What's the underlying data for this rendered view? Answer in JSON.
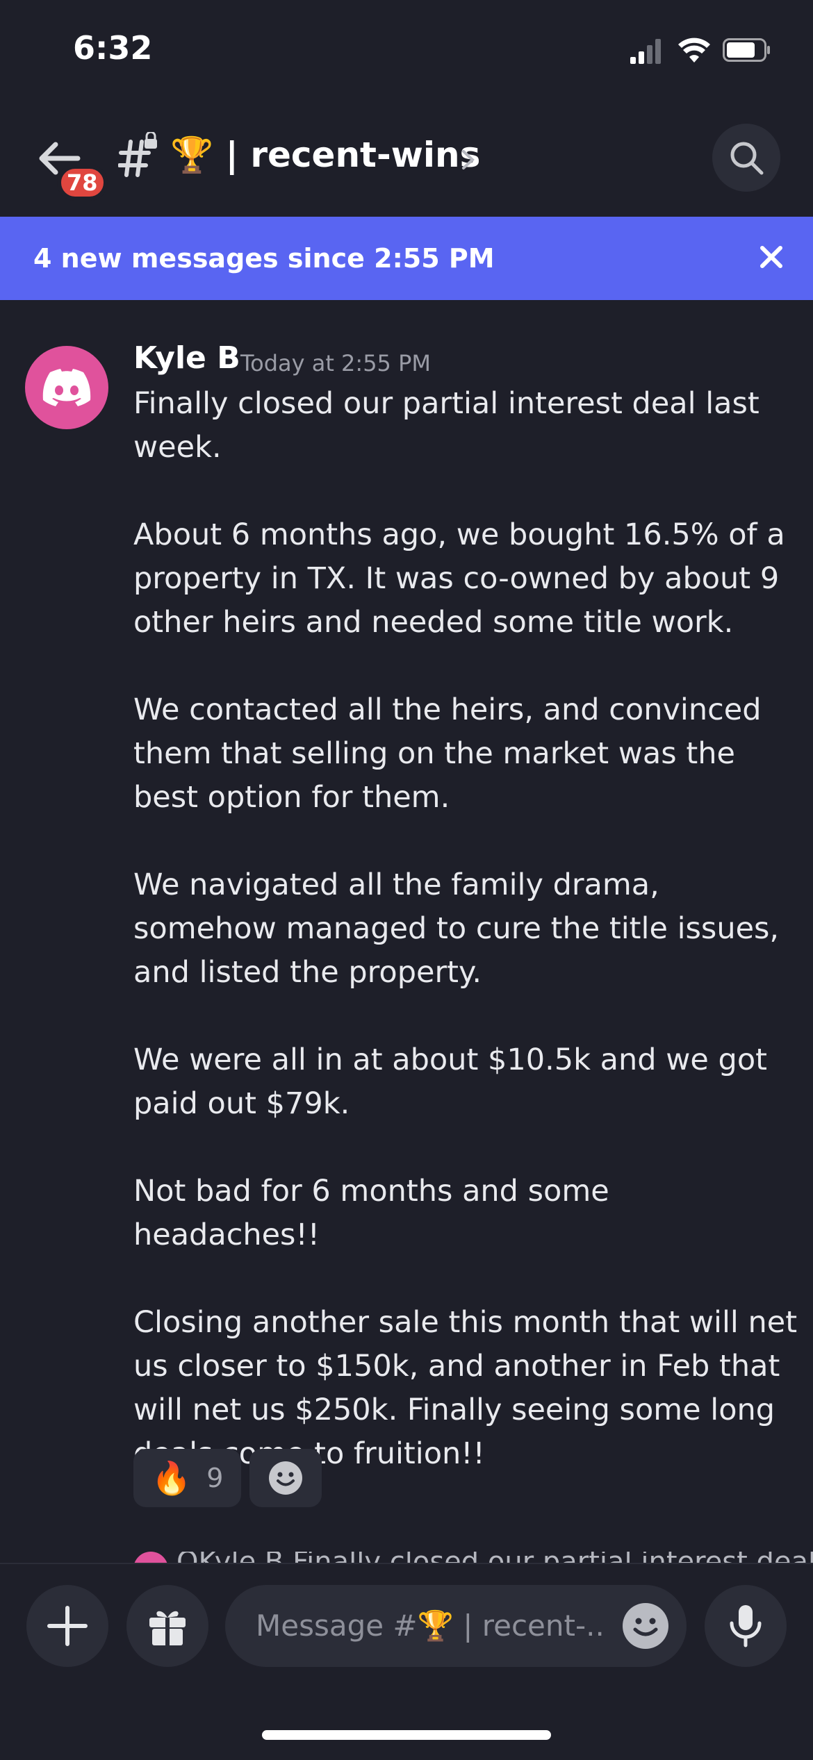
{
  "status_bar": {
    "time": "6:32"
  },
  "header": {
    "unread_badge": "78",
    "channel_name": "🏆 | recent-wins"
  },
  "new_messages_bar": {
    "text": "4 new messages since 2:55 PM"
  },
  "message": {
    "author": "Kyle B",
    "timestamp": "Today at 2:55 PM",
    "paragraphs": [
      "Finally closed our partial interest deal last week.",
      "About 6 months ago, we bought 16.5% of a property in TX. It was co-owned by about 9 other heirs and needed some title work.",
      "We contacted all the heirs, and convinced them that selling on the market was the best option for them.",
      "We navigated all the family drama, somehow managed to cure the title issues, and listed the property.",
      "We were all in at about $10.5k and we got paid out $79k.",
      "Not bad for 6 months and some headaches!!",
      "Closing another sale this month that will net us closer to $150k, and another in Feb that will net us $250k. Finally seeing some long deals come to fruition!!"
    ],
    "reactions": [
      {
        "emoji": "🔥",
        "count": "9"
      }
    ]
  },
  "next_message_peek": "OKyle B Finally closed our partial interest deal",
  "composer": {
    "placeholder": "Message #🏆 | recent-.."
  },
  "colors": {
    "background": "#1e1f29",
    "banner": "#5965f2",
    "avatar": "#e0529c",
    "badge": "#e0463f",
    "surface": "#2b2d38"
  }
}
